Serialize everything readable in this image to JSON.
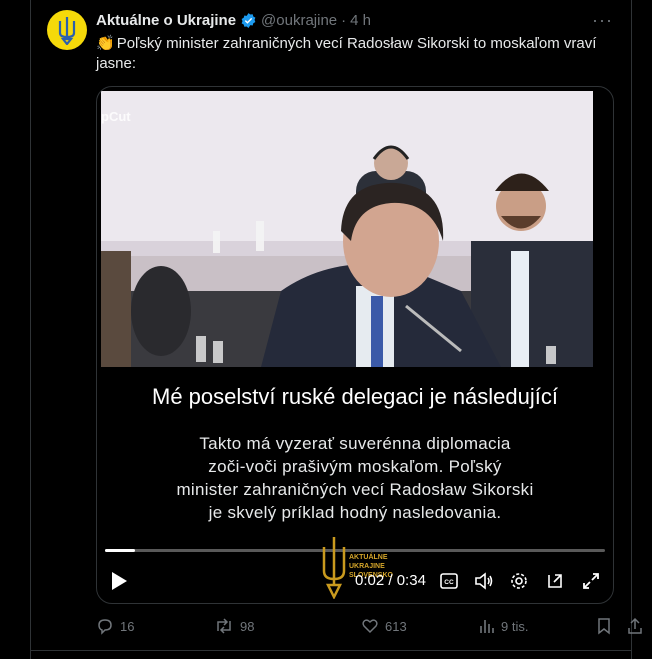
{
  "post": {
    "author_name": "Aktuálne o Ukrajine",
    "handle": "@oukrajine",
    "separator": "·",
    "time_ago": "4 h",
    "emoji": "👏",
    "text": "Poľský minister zahraničných vecí Radosław Sikorski to moskaľom vraví jasne:",
    "more_label": "···"
  },
  "video": {
    "top_watermark": "pCut",
    "subtitle": "Mé poselství ruské delegaci je následující",
    "caption_lines": [
      "Takto má vyzerať suverénna diplomacia",
      "zoči-voči prašivým moskaľom. Poľský",
      "minister zahraničných vecí Radosław Sikorski",
      "je skvelý príklad hodný nasledovania."
    ],
    "current_time": "0:02",
    "duration": "0:34",
    "progress": 0.06,
    "logo_lines": [
      "AKTUÁLNE",
      "UKRAJINE",
      "SLOVENSKO"
    ]
  },
  "actions": {
    "replies": "16",
    "reposts": "98",
    "likes": "613",
    "views": "9 tis."
  },
  "colors": {
    "accent": "#1d9bf0",
    "avatar_bg": "#f5d90a",
    "muted": "#71767b"
  }
}
